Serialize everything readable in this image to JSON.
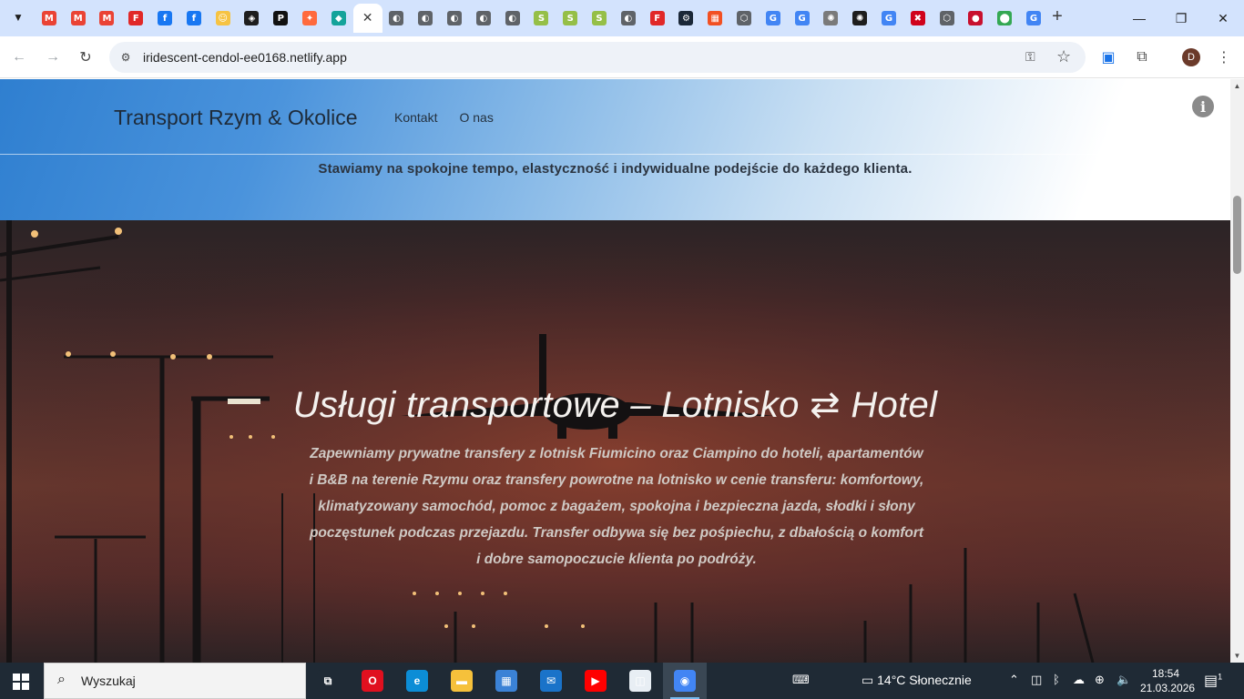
{
  "browser": {
    "tabs": [
      {
        "icon": "gmail-icon",
        "color": "#ea4335",
        "glyph": "M"
      },
      {
        "icon": "gmail-icon",
        "color": "#ea4335",
        "glyph": "M"
      },
      {
        "icon": "gmail-icon",
        "color": "#ea4335",
        "glyph": "M"
      },
      {
        "icon": "flipboard-icon",
        "color": "#e12828",
        "glyph": "F"
      },
      {
        "icon": "facebook-icon",
        "color": "#1877f2",
        "glyph": "f"
      },
      {
        "icon": "facebook-icon",
        "color": "#1877f2",
        "glyph": "f"
      },
      {
        "icon": "emoji-icon",
        "color": "#f6c343",
        "glyph": "☺"
      },
      {
        "icon": "codepen-icon",
        "color": "#1e1e1e",
        "glyph": "◈"
      },
      {
        "icon": "pixabay-icon",
        "color": "#111111",
        "glyph": "P"
      },
      {
        "icon": "sparkle-icon",
        "color": "#ff6a3d",
        "glyph": "✦"
      },
      {
        "icon": "diamond-icon",
        "color": "#14a39a",
        "glyph": "◆"
      },
      {
        "icon": "close-icon",
        "color": "#ffffff",
        "glyph": "✕",
        "active": true
      },
      {
        "icon": "globe-icon",
        "color": "#5f6368",
        "glyph": "◐"
      },
      {
        "icon": "globe-icon",
        "color": "#5f6368",
        "glyph": "◐"
      },
      {
        "icon": "globe-icon",
        "color": "#5f6368",
        "glyph": "◐"
      },
      {
        "icon": "globe-icon",
        "color": "#5f6368",
        "glyph": "◐"
      },
      {
        "icon": "globe-icon",
        "color": "#5f6368",
        "glyph": "◐"
      },
      {
        "icon": "shopify-icon",
        "color": "#95bf47",
        "glyph": "S"
      },
      {
        "icon": "shopify-icon",
        "color": "#95bf47",
        "glyph": "S"
      },
      {
        "icon": "shopify-icon",
        "color": "#95bf47",
        "glyph": "S"
      },
      {
        "icon": "globe-icon",
        "color": "#5f6368",
        "glyph": "◐"
      },
      {
        "icon": "flipboard-icon",
        "color": "#e12828",
        "glyph": "F"
      },
      {
        "icon": "steam-icon",
        "color": "#1b2838",
        "glyph": "⚙"
      },
      {
        "icon": "microsoft-icon",
        "color": "#f25022",
        "glyph": "▦"
      },
      {
        "icon": "shield-icon",
        "color": "#5f6368",
        "glyph": "⬡"
      },
      {
        "icon": "google-icon",
        "color": "#4285f4",
        "glyph": "G"
      },
      {
        "icon": "google-icon",
        "color": "#4285f4",
        "glyph": "G"
      },
      {
        "icon": "openai-icon",
        "color": "#7a7a7a",
        "glyph": "✺"
      },
      {
        "icon": "openai-icon",
        "color": "#1e1e1e",
        "glyph": "✺"
      },
      {
        "icon": "google-icon",
        "color": "#4285f4",
        "glyph": "G"
      },
      {
        "icon": "red-x-icon",
        "color": "#d0021b",
        "glyph": "✖"
      },
      {
        "icon": "shield-icon",
        "color": "#5f6368",
        "glyph": "⬡"
      },
      {
        "icon": "red-dot-icon",
        "color": "#c8102e",
        "glyph": "●"
      },
      {
        "icon": "maps-icon",
        "color": "#34a853",
        "glyph": "⬤"
      },
      {
        "icon": "google-icon",
        "color": "#4285f4",
        "glyph": "G"
      }
    ],
    "url": "iridescent-cendol-ee0168.netlify.app",
    "profile_initial": "D"
  },
  "site": {
    "brand": "Transport Rzym & Okolice",
    "nav": [
      "Kontakt",
      "O nas"
    ],
    "tagline": "Stawiamy na spokojne tempo, elastyczność i indywidualne podejście do każdego klienta.",
    "hero_title": "Usługi transportowe – Lotnisko ⇄ Hotel",
    "hero_text": "Zapewniamy prywatne transfery z lotnisk Fiumicino oraz Ciampino do hoteli, apartamentów i B&B na terenie Rzymu oraz transfery powrotne na lotnisko w cenie transferu: komfortowy, klimatyzowany samochód, pomoc z bagażem, spokojna i bezpieczna jazda, słodki i słony poczęstunek podczas przejazdu. Transfer odbywa się bez pośpiechu, z dbałością o komfort i dobre samopoczucie klienta po podróży."
  },
  "taskbar": {
    "search_label": "Wyszukaj",
    "apps": [
      {
        "icon": "task-view-icon",
        "color": "#1f2a35",
        "glyph": "⧉"
      },
      {
        "icon": "opera-icon",
        "color": "#e0101f",
        "glyph": "O"
      },
      {
        "icon": "edge-icon",
        "color": "#0c8dd6",
        "glyph": "e"
      },
      {
        "icon": "file-explorer-icon",
        "color": "#f6c13b",
        "glyph": "▬"
      },
      {
        "icon": "store-icon",
        "color": "#3b82d6",
        "glyph": "▦"
      },
      {
        "icon": "mail-icon",
        "color": "#1a73c9",
        "glyph": "✉"
      },
      {
        "icon": "youtube-icon",
        "color": "#ff0000",
        "glyph": "▶"
      },
      {
        "icon": "sketchup-icon",
        "color": "#e8eef4",
        "glyph": "◫"
      },
      {
        "icon": "chrome-icon",
        "color": "#4285f4",
        "glyph": "◉",
        "active": true
      }
    ],
    "weather": "14°C  Słonecznie",
    "time": "18:54",
    "date": "21.03.2026",
    "notification_count": "1"
  }
}
